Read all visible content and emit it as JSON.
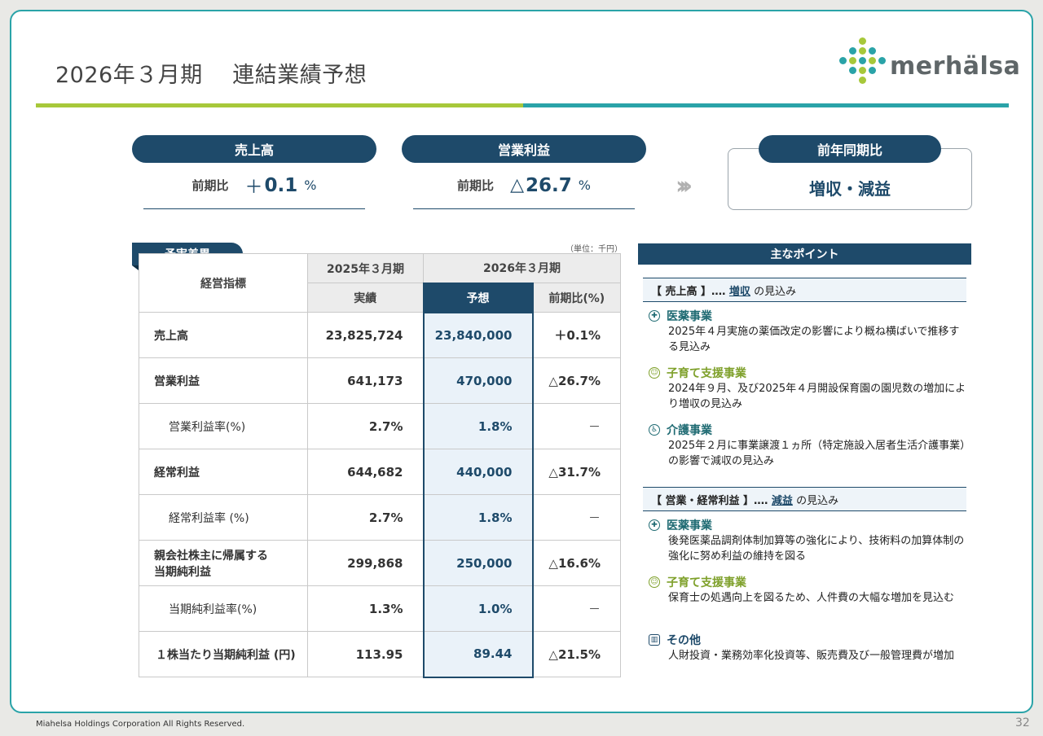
{
  "title": "2026年３月期　 連結業績予想",
  "logo": {
    "text": "merhälsa"
  },
  "kpis": [
    {
      "label": "売上高",
      "row_label": "前期比",
      "sign": "＋",
      "value": "0.1",
      "unit": "%"
    },
    {
      "label": "営業利益",
      "row_label": "前期比",
      "sign": "△",
      "value": "26.7",
      "unit": "%"
    }
  ],
  "yoy": {
    "label": "前年同期比",
    "value": "増収・減益"
  },
  "table": {
    "tab": "予実差異",
    "unit_note": "（単位：千円）",
    "header_metric": "経営指標",
    "header_fy2025": "2025年３月期",
    "header_fy2026": "2026年３月期",
    "sub_actual": "実績",
    "sub_forecast": "予想",
    "sub_yoy": "前期比(%)",
    "rows": [
      {
        "label": "売上高",
        "actual": "23,825,724",
        "forecast": "23,840,000",
        "yoy": "＋0.1%"
      },
      {
        "label": "営業利益",
        "actual": "641,173",
        "forecast": "470,000",
        "yoy": "△26.7%"
      },
      {
        "label": "営業利益率(%)",
        "actual": "2.7%",
        "forecast": "1.8%",
        "yoy": "－"
      },
      {
        "label": "経常利益",
        "actual": "644,682",
        "forecast": "440,000",
        "yoy": "△31.7%"
      },
      {
        "label": "経常利益率 (%)",
        "actual": "2.7%",
        "forecast": "1.8%",
        "yoy": "－"
      },
      {
        "label_line1": "親会社株主に帰属する",
        "label_line2": "当期純利益",
        "actual": "299,868",
        "forecast": "250,000",
        "yoy": "△16.6%"
      },
      {
        "label": "当期純利益率(%)",
        "actual": "1.3%",
        "forecast": "1.0%",
        "yoy": "－"
      },
      {
        "label": "１株当たり当期純利益 (円)",
        "actual": "113.95",
        "forecast": "89.44",
        "yoy": "△21.5%"
      }
    ]
  },
  "points": {
    "header": "主なポイント",
    "sales": {
      "prefix": "【 売上高 】‥‥ ",
      "keyword": "増収",
      "suffix": " の見込み",
      "items": [
        {
          "icon": "medical-icon",
          "title": "医薬事業",
          "text": "2025年４月実施の薬価改定の影響により概ね横ばいで推移する見込み"
        },
        {
          "icon": "childcare-icon",
          "title": "子育て支援事業",
          "text": "2024年９月、及び2025年４月開設保育園の園児数の増加により増収の見込み"
        },
        {
          "icon": "nursing-care-icon",
          "title": "介護事業",
          "text": "2025年２月に事業譲渡１ヵ所（特定施設入居者生活介護事業）の影響で減収の見込み"
        }
      ]
    },
    "profit": {
      "prefix": "【 営業・経常利益 】‥‥ ",
      "keyword": "減益",
      "suffix": " の見込み",
      "items": [
        {
          "icon": "medical-icon",
          "title": "医薬事業",
          "text": "後発医薬品調剤体制加算等の強化により、技術料の加算体制の強化に努め利益の維持を図る"
        },
        {
          "icon": "childcare-icon",
          "title": "子育て支援事業",
          "text": "保育士の処遇向上を図るため、人件費の大幅な増加を見込む"
        },
        {
          "icon": "building-icon",
          "title": "その他",
          "text": "人財投資・業務効率化投資等、販売費及び一般管理費が増加"
        }
      ]
    }
  },
  "footer": "Miahelsa Holdings Corporation All Rights Reserved.",
  "page_number": "32",
  "colors": {
    "navy": "#1e4a6a",
    "teal": "#2aa3a8",
    "green": "#a7c83a",
    "forecast_bg": "#eaf2f9"
  }
}
